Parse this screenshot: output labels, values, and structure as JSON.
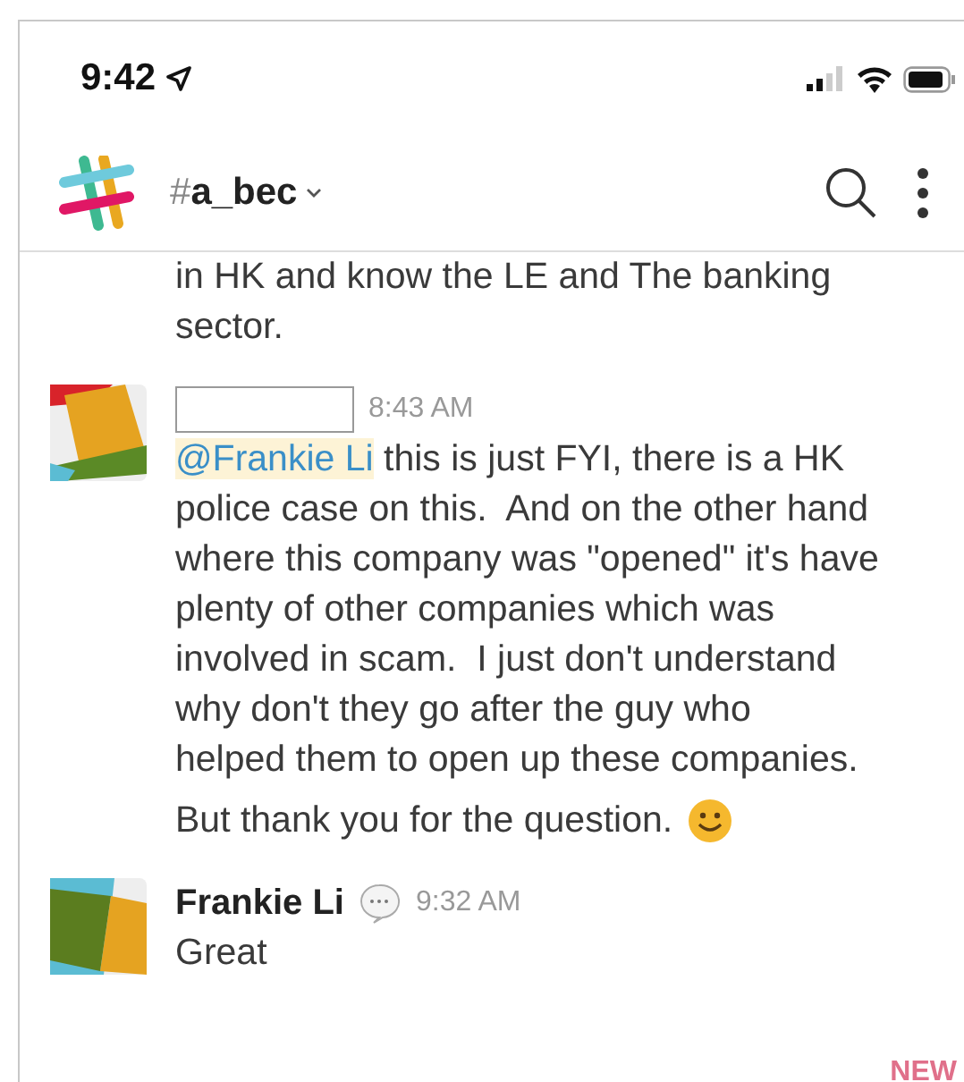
{
  "status_bar": {
    "time": "9:42"
  },
  "header": {
    "channel_prefix": "#",
    "channel": "a_bec"
  },
  "messages": [
    {
      "kind": "continuation",
      "lines": [
        "in HK and know the LE and The banking",
        "sector."
      ]
    },
    {
      "kind": "redacted_author",
      "time": "8:43 AM",
      "mention": "@Frankie Li",
      "lines": [
        " this is just FYI, there is a HK",
        "police case on this.  And on the other hand",
        "where this company was \"opened\" it's have",
        "plenty of other companies which was",
        "involved in scam.  I just don't understand",
        "why don't they go after the guy who",
        "helped them to open up these companies."
      ],
      "closing": "But thank you for the question.",
      "emoji": true
    },
    {
      "kind": "named_author",
      "author": "Frankie Li",
      "thread_icon": true,
      "time": "9:32 AM",
      "lines": [
        "Great"
      ]
    }
  ],
  "new_marker": "NEW"
}
